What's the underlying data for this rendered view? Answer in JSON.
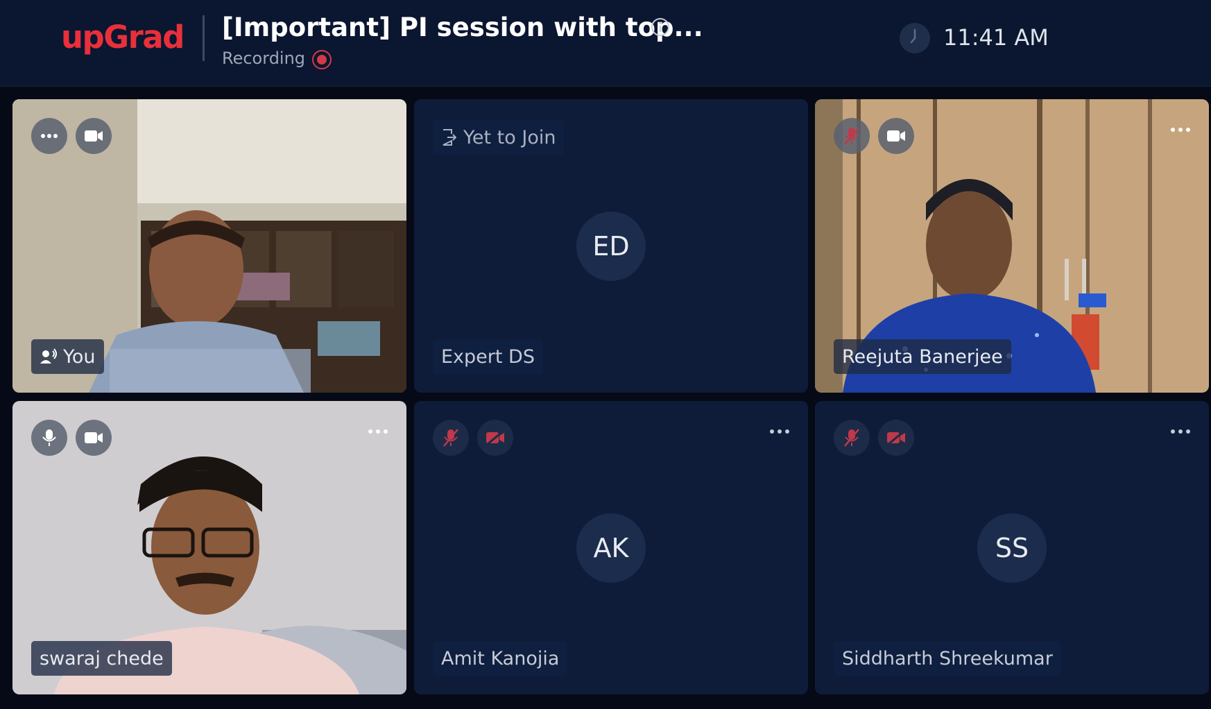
{
  "header": {
    "logo": "upGrad",
    "title": "[Important] PI session with top...",
    "recording_label": "Recording",
    "time": "11:41 AM"
  },
  "colors": {
    "brand": "#e8303a",
    "header_bg": "#0b1630",
    "tile_bg": "#0e1c3a",
    "muted_red": "#c0394a"
  },
  "participants": [
    {
      "name": "You",
      "video": true,
      "mic_icon": "dots-icon",
      "cam_icon": "video-camera-icon",
      "speaking": true
    },
    {
      "name": "Expert DS",
      "status": "Yet to Join",
      "initials": "ED",
      "video": false
    },
    {
      "name": "Reejuta Banerjee",
      "video": true,
      "mic_icon": "mic-off-icon",
      "cam_icon": "video-camera-icon"
    },
    {
      "name": "swaraj chede",
      "video": true,
      "mic_icon": "mic-icon",
      "cam_icon": "video-camera-icon"
    },
    {
      "name": "Amit Kanojia",
      "initials": "AK",
      "video": false,
      "mic_icon": "mic-off-icon",
      "cam_icon": "video-off-icon"
    },
    {
      "name": "Siddharth Shreekumar",
      "initials": "SS",
      "video": false,
      "mic_icon": "mic-off-icon",
      "cam_icon": "video-off-icon"
    }
  ]
}
